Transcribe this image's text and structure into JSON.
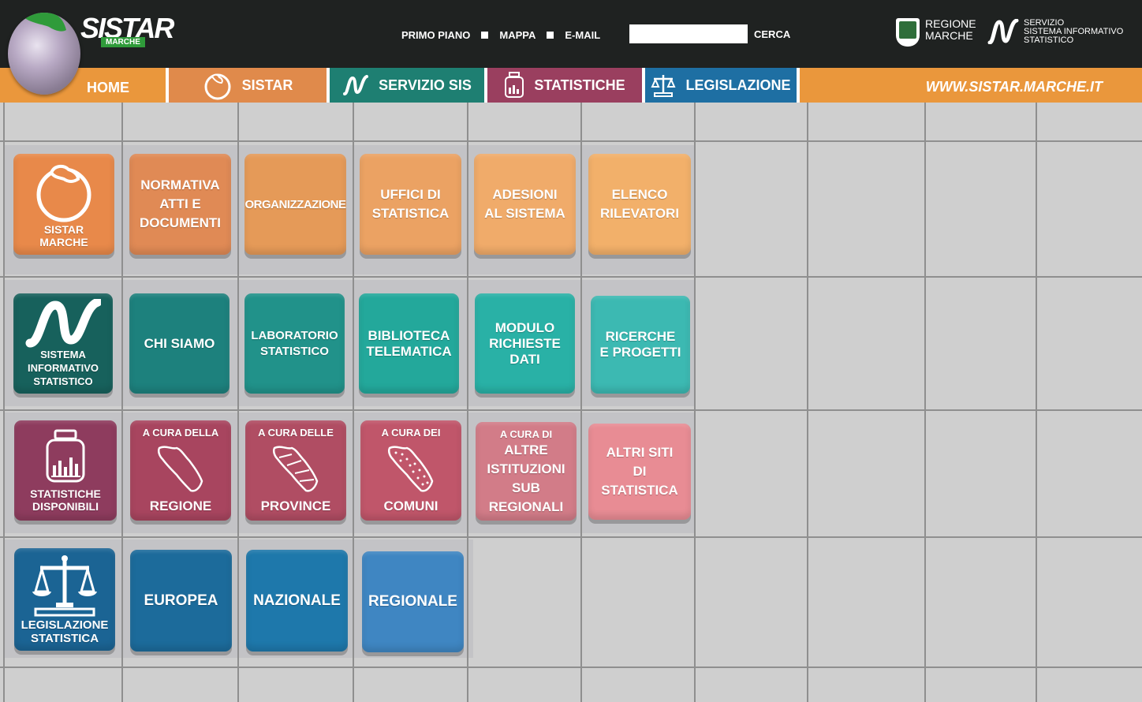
{
  "header": {
    "logo_text": "SISTAR",
    "logo_sub": "MARCHE",
    "top_nav": [
      "PRIMO PIANO",
      "MAPPA",
      "E-MAIL"
    ],
    "search_label": "CERCA",
    "search_value": "",
    "regione_line1": "REGIONE",
    "regione_line2": "MARCHE",
    "servizio_line1": "SERVIZIO",
    "servizio_line2": "SISTEMA INFORMATIVO",
    "servizio_line3": "STATISTICO"
  },
  "tabs": {
    "home": "HOME",
    "sistar": "SISTAR",
    "sis": "SERVIZIO SIS",
    "stat": "STATISTICHE",
    "leg": "LEGISLAZIONE",
    "url": "WWW.SISTAR.MARCHE.IT"
  },
  "colors": {
    "row1": [
      "#e8894a",
      "#e08a55",
      "#e59a58",
      "#eba263",
      "#f0ab6a",
      "#f2b06a"
    ],
    "row2": [
      "#17615c",
      "#1d817d",
      "#21928a",
      "#23a89b",
      "#29b1a6",
      "#3cb9b2"
    ],
    "row3": [
      "#8e3c5e",
      "#a8455f",
      "#b04d63",
      "#c0566a",
      "#d27c88",
      "#e88c94"
    ],
    "row4": [
      "#1b6494",
      "#1c6b9b",
      "#1e78ab",
      "#3f86c2"
    ]
  },
  "tiles": {
    "row1": [
      {
        "line1": "SISTAR",
        "line2": "MARCHE"
      },
      {
        "line1": "NORMATIVA",
        "line2": "ATTI E",
        "line3": "DOCUMENTI"
      },
      {
        "line1": "ORGANIZZAZIONE"
      },
      {
        "line1": "UFFICI DI",
        "line2": "STATISTICA"
      },
      {
        "line1": "ADESIONI",
        "line2": "AL SISTEMA"
      },
      {
        "line1": "ELENCO",
        "line2": "RILEVATORI"
      }
    ],
    "row2": [
      {
        "line1": "SISTEMA",
        "line2": "INFORMATIVO",
        "line3": "STATISTICO"
      },
      {
        "line1": "CHI SIAMO"
      },
      {
        "line1": "LABORATORIO",
        "line2": "STATISTICO"
      },
      {
        "line1": "BIBLIOTECA",
        "line2": "TELEMATICA"
      },
      {
        "line1": "MODULO",
        "line2": "RICHIESTE",
        "line3": "DATI"
      },
      {
        "line1": "RICERCHE",
        "line2": "E PROGETTI"
      }
    ],
    "row3": [
      {
        "line1": "STATISTICHE",
        "line2": "DISPONIBILI"
      },
      {
        "pre": "A CURA DELLA",
        "line1": "REGIONE"
      },
      {
        "pre": "A CURA DELLE",
        "line1": "PROVINCE"
      },
      {
        "pre": "A CURA DEI",
        "line1": "COMUNI"
      },
      {
        "pre": "A CURA DI",
        "line1": "ALTRE",
        "line2": "ISTITUZIONI",
        "line3": "SUB",
        "line4": "REGIONALI"
      },
      {
        "line1": "ALTRI SITI",
        "line2": "DI",
        "line3": "STATISTICA"
      }
    ],
    "row4": [
      {
        "line1": "LEGISLAZIONE",
        "line2": "STATISTICA"
      },
      {
        "line1": "EUROPEA"
      },
      {
        "line1": "NAZIONALE"
      },
      {
        "line1": "REGIONALE"
      }
    ]
  },
  "icons": {
    "globe": "globe-map-icon",
    "sistar": "marche-region-circle-icon",
    "sis": "sis-wave-logo-icon",
    "stat": "data-jar-chart-icon",
    "leg": "balance-scale-icon",
    "region_map": "region-map-icon",
    "province_map": "province-map-icon",
    "comuni_map": "comuni-map-icon"
  }
}
